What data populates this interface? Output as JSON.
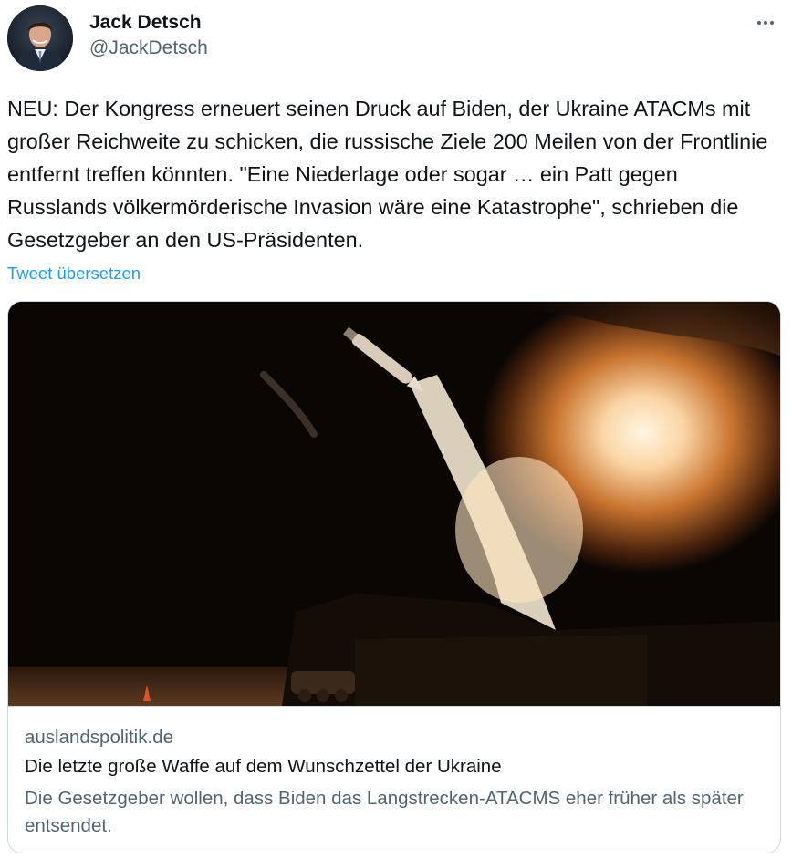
{
  "author": {
    "display_name": "Jack Detsch",
    "handle": "@JackDetsch",
    "avatar_icon": "user-avatar-photo"
  },
  "more_icon": "more-options-icon",
  "tweet": {
    "text": "NEU: Der Kongress erneuert seinen Druck auf Biden, der Ukraine ATACMs mit großer Reichweite zu schicken, die russische Ziele 200 Meilen von der Frontlinie entfernt treffen könnten. \"Eine Niederlage oder sogar … ein Patt gegen Russlands völkermörderische Invasion wäre eine Katastrophe\", schrieben die Gesetzgeber an den US-Präsidenten.",
    "translate_label": "Tweet übersetzen"
  },
  "card": {
    "image_icon": "missile-launch-photo",
    "domain": "auslandspolitik.de",
    "title": "Die letzte große Waffe auf dem Wunschzettel der Ukraine",
    "description": "Die Gesetzgeber wollen, dass Biden das Langstrecken-ATACMS eher früher als später entsendet."
  },
  "colors": {
    "text_primary": "#0f1419",
    "text_secondary": "#536471",
    "link": "#1d9bf0",
    "border": "#cfd9de"
  }
}
